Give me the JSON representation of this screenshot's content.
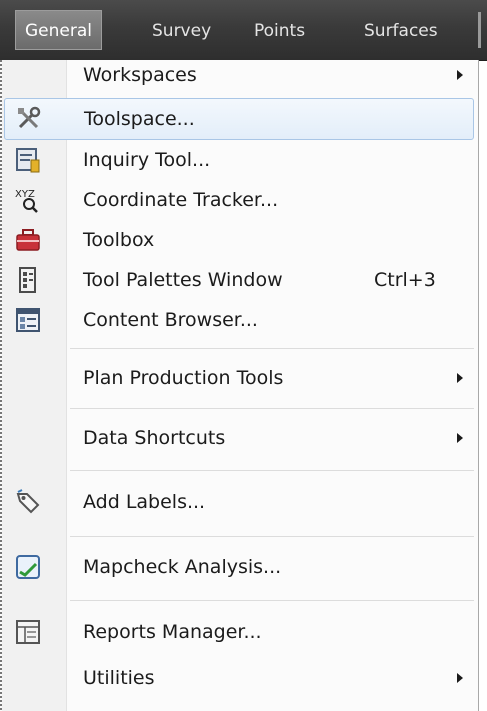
{
  "menubar": {
    "tabs": [
      {
        "label": "General",
        "active": true
      },
      {
        "label": "Survey"
      },
      {
        "label": "Points"
      },
      {
        "label": "Surfaces"
      }
    ]
  },
  "menu": {
    "items": [
      {
        "label": "Workspaces",
        "submenu": true
      },
      {
        "label": "Toolspace...",
        "icon": "toolspace-icon",
        "highlighted": true
      },
      {
        "label": "Inquiry Tool...",
        "icon": "inquiry-tool-icon"
      },
      {
        "label": "Coordinate Tracker...",
        "icon": "coordinate-tracker-icon"
      },
      {
        "label": "Toolbox",
        "icon": "toolbox-icon"
      },
      {
        "label": "Tool Palettes Window",
        "shortcut": "Ctrl+3",
        "icon": "tool-palettes-icon"
      },
      {
        "label": "Content Browser...",
        "icon": "content-browser-icon"
      },
      {
        "label": "Plan Production Tools",
        "submenu": true
      },
      {
        "label": "Data Shortcuts",
        "submenu": true
      },
      {
        "label": "Add Labels...",
        "icon": "add-labels-icon"
      },
      {
        "label": "Mapcheck Analysis...",
        "icon": "mapcheck-icon"
      },
      {
        "label": "Reports Manager...",
        "icon": "reports-manager-icon"
      },
      {
        "label": "Utilities",
        "submenu": true
      }
    ]
  },
  "colors": {
    "menubar_bg": "#3a3a3a",
    "active_tab_bg": "#7a7a7a",
    "hover_border": "#a9c6e6",
    "toolbox_red": "#c8323a"
  }
}
